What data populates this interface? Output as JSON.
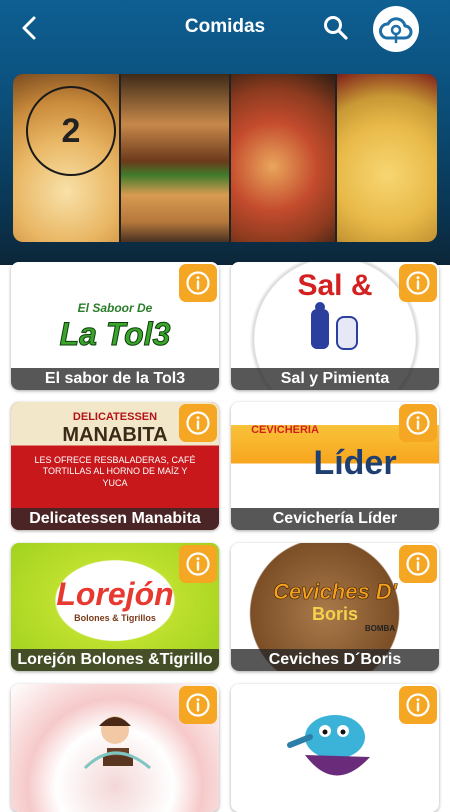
{
  "appbar": {
    "title": "Comidas"
  },
  "banner": {
    "slide_number": "2"
  },
  "restaurants": [
    {
      "name": "El sabor de la Tol3",
      "logo_text": "La Tol3",
      "logo_sub": "El Saboor De"
    },
    {
      "name": "Sal y Pimienta",
      "logo_text": "Sal &",
      "logo_sub": ""
    },
    {
      "name": "Delicatessen Manabita",
      "logo_text": "MANABITA",
      "logo_sub": "DELICATESSEN",
      "logo_note": "LES OFRECE RESBALADERAS, CAFÉ TORTILLAS AL HORNO DE MAÍZ Y YUCA"
    },
    {
      "name": "Cevichería Líder",
      "logo_text": "Líder",
      "logo_sub": "CEVICHERIA"
    },
    {
      "name": "Lorejón Bolones &Tigrillo",
      "logo_text": "Lorejón",
      "logo_sub": "Bolones & Tigrillos"
    },
    {
      "name": "Ceviches D´Boris",
      "logo_text": "Ceviches D'",
      "logo_sub": "Boris",
      "logo_note": "BOMBA"
    },
    {
      "name": "",
      "logo_text": "",
      "logo_sub": ""
    },
    {
      "name": "",
      "logo_text": "",
      "logo_sub": ""
    }
  ],
  "colors": {
    "accent": "#f5a623",
    "appbar": "#0e5f93"
  },
  "icons": {
    "back": "chevron-left-icon",
    "search": "search-icon",
    "cloud": "cloud-location-icon",
    "info": "info-icon"
  }
}
